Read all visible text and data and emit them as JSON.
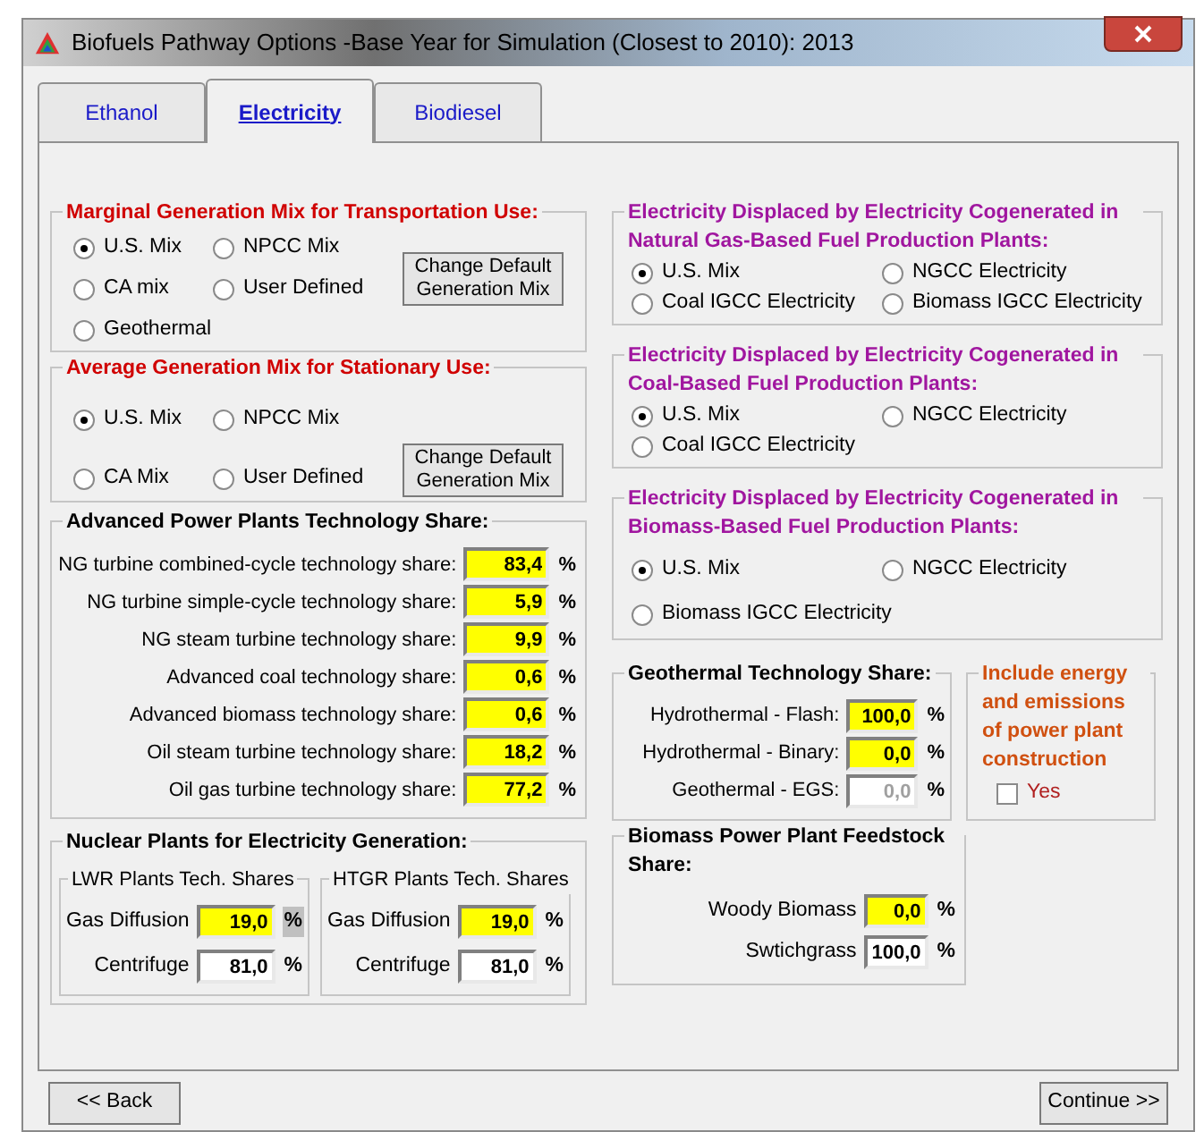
{
  "window": {
    "title": "Biofuels Pathway Options -Base Year for Simulation (Closest to 2010): 2013"
  },
  "tabs": [
    {
      "label": "Ethanol",
      "selected": false
    },
    {
      "label": "Electricity",
      "selected": true
    },
    {
      "label": "Biodiesel",
      "selected": false
    }
  ],
  "marginal_mix": {
    "title": "Marginal Generation Mix for Transportation Use:",
    "options": [
      {
        "label": "U.S. Mix",
        "selected": true
      },
      {
        "label": "NPCC Mix",
        "selected": false
      },
      {
        "label": "CA mix",
        "selected": false
      },
      {
        "label": "User Defined",
        "selected": false
      },
      {
        "label": "Geothermal",
        "selected": false
      }
    ],
    "button": "Change Default Generation Mix"
  },
  "average_mix": {
    "title": "Average Generation Mix for Stationary Use:",
    "options": [
      {
        "label": "U.S. Mix",
        "selected": true
      },
      {
        "label": "NPCC Mix",
        "selected": false
      },
      {
        "label": "CA Mix",
        "selected": false
      },
      {
        "label": "User Defined",
        "selected": false
      }
    ],
    "button": "Change Default Generation Mix"
  },
  "advanced_power_plants": {
    "title": "Advanced Power Plants Technology Share:",
    "fields": [
      {
        "label": "NG turbine combined-cycle technology share:",
        "value": "83,4",
        "unit": "%",
        "highlighted": true,
        "disabled": false
      },
      {
        "label": "NG turbine simple-cycle technology share:",
        "value": "5,9",
        "unit": "%",
        "highlighted": true,
        "disabled": false
      },
      {
        "label": "NG steam turbine technology share:",
        "value": "9,9",
        "unit": "%",
        "highlighted": true,
        "disabled": false
      },
      {
        "label": "Advanced coal technology share:",
        "value": "0,6",
        "unit": "%",
        "highlighted": true,
        "disabled": false
      },
      {
        "label": "Advanced biomass technology share:",
        "value": "0,6",
        "unit": "%",
        "highlighted": true,
        "disabled": false
      },
      {
        "label": "Oil steam turbine technology share:",
        "value": "18,2",
        "unit": "%",
        "highlighted": true,
        "disabled": false
      },
      {
        "label": "Oil gas turbine technology share:",
        "value": "77,2",
        "unit": "%",
        "highlighted": true,
        "disabled": false
      }
    ]
  },
  "nuclear": {
    "title": "Nuclear Plants for Electricity Generation:",
    "groups": [
      {
        "title": "LWR Plants Tech. Shares",
        "fields": [
          {
            "label": "Gas Diffusion",
            "value": "19,0",
            "unit": "%",
            "highlighted": true,
            "disabled": false,
            "focused": true
          },
          {
            "label": "Centrifuge",
            "value": "81,0",
            "unit": "%",
            "highlighted": false,
            "disabled": false,
            "focused": false
          }
        ]
      },
      {
        "title": "HTGR Plants Tech. Shares",
        "fields": [
          {
            "label": "Gas Diffusion",
            "value": "19,0",
            "unit": "%",
            "highlighted": true,
            "disabled": false,
            "focused": false
          },
          {
            "label": "Centrifuge",
            "value": "81,0",
            "unit": "%",
            "highlighted": false,
            "disabled": false,
            "focused": false
          }
        ]
      }
    ]
  },
  "cogen_natural_gas": {
    "title": "Electricity Displaced by Electricity Cogenerated in Natural Gas-Based Fuel Production Plants:",
    "options": [
      {
        "label": "U.S. Mix",
        "selected": true
      },
      {
        "label": "NGCC Electricity",
        "selected": false
      },
      {
        "label": "Coal IGCC Electricity",
        "selected": false
      },
      {
        "label": "Biomass IGCC Electricity",
        "selected": false
      }
    ]
  },
  "cogen_coal": {
    "title": "Electricity Displaced by Electricity Cogenerated in Coal-Based Fuel Production Plants:",
    "options": [
      {
        "label": "U.S. Mix",
        "selected": true
      },
      {
        "label": "NGCC Electricity",
        "selected": false
      },
      {
        "label": "Coal IGCC Electricity",
        "selected": false
      }
    ]
  },
  "cogen_biomass": {
    "title": "Electricity Displaced by Electricity Cogenerated in Biomass-Based Fuel Production Plants:",
    "options": [
      {
        "label": "U.S. Mix",
        "selected": true
      },
      {
        "label": "NGCC Electricity",
        "selected": false
      },
      {
        "label": "Biomass IGCC Electricity",
        "selected": false
      }
    ]
  },
  "geothermal": {
    "title": "Geothermal Technology Share:",
    "fields": [
      {
        "label": "Hydrothermal - Flash:",
        "value": "100,0",
        "unit": "%",
        "highlighted": true,
        "disabled": false
      },
      {
        "label": "Hydrothermal - Binary:",
        "value": "0,0",
        "unit": "%",
        "highlighted": true,
        "disabled": false
      },
      {
        "label": "Geothermal - EGS:",
        "value": "0,0",
        "unit": "%",
        "highlighted": false,
        "disabled": true
      }
    ]
  },
  "construction": {
    "title": "Include energy and emissions of power plant construction",
    "checkbox": {
      "label": "Yes",
      "checked": false
    }
  },
  "feedstock": {
    "title": "Biomass Power Plant Feedstock Share:",
    "fields": [
      {
        "label": "Woody Biomass",
        "value": "0,0",
        "unit": "%",
        "highlighted": true,
        "disabled": false
      },
      {
        "label": "Swtichgrass",
        "value": "100,0",
        "unit": "%",
        "highlighted": false,
        "disabled": false
      }
    ]
  },
  "buttons": {
    "back": "<< Back",
    "continue": "Continue >>"
  }
}
